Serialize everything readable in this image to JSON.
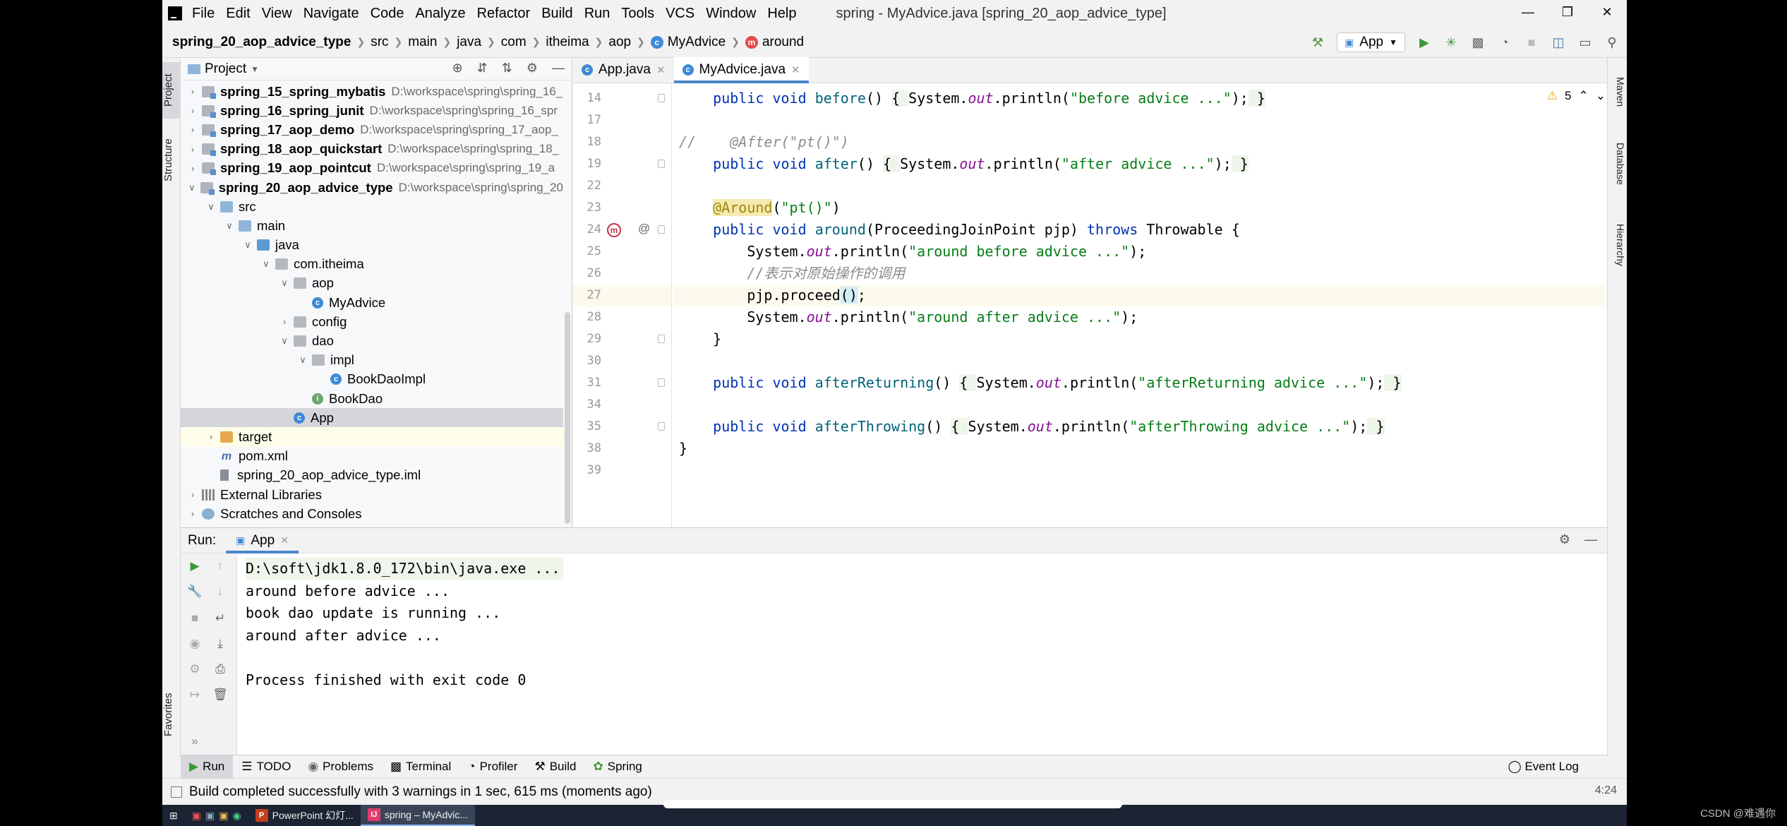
{
  "window": {
    "title": "spring - MyAdvice.java [spring_20_aop_advice_type]",
    "controls": [
      "minimize",
      "maximize",
      "close"
    ]
  },
  "menu": [
    "File",
    "Edit",
    "View",
    "Navigate",
    "Code",
    "Analyze",
    "Refactor",
    "Build",
    "Run",
    "Tools",
    "VCS",
    "Window",
    "Help"
  ],
  "breadcrumb": [
    "spring_20_aop_advice_type",
    "src",
    "main",
    "java",
    "com",
    "itheima",
    "aop",
    "MyAdvice",
    "around"
  ],
  "toolbar": {
    "run_config": "App"
  },
  "left_strip": {
    "project": "Project",
    "structure": "Structure",
    "favorites": "Favorites"
  },
  "right_strip": [
    "Maven",
    "Database",
    "Hierarchy"
  ],
  "project_panel": {
    "title": "Project",
    "tree": [
      {
        "name": "spring_15_spring_mybatis",
        "path": "D:\\workspace\\spring\\spring_16_",
        "level": 0,
        "arrow": ">",
        "icon": "module",
        "bold": true
      },
      {
        "name": "spring_16_spring_junit",
        "path": "D:\\workspace\\spring\\spring_16_spr",
        "level": 0,
        "arrow": ">",
        "icon": "module",
        "bold": true
      },
      {
        "name": "spring_17_aop_demo",
        "path": "D:\\workspace\\spring\\spring_17_aop_",
        "level": 0,
        "arrow": ">",
        "icon": "module",
        "bold": true
      },
      {
        "name": "spring_18_aop_quickstart",
        "path": "D:\\workspace\\spring\\spring_18_",
        "level": 0,
        "arrow": ">",
        "icon": "module",
        "bold": true
      },
      {
        "name": "spring_19_aop_pointcut",
        "path": "D:\\workspace\\spring\\spring_19_a",
        "level": 0,
        "arrow": ">",
        "icon": "module",
        "bold": true
      },
      {
        "name": "spring_20_aop_advice_type",
        "path": "D:\\workspace\\spring\\spring_20",
        "level": 0,
        "arrow": "v",
        "icon": "module",
        "bold": true
      },
      {
        "name": "src",
        "path": "",
        "level": 1,
        "arrow": "v",
        "icon": "folder",
        "bold": false
      },
      {
        "name": "main",
        "path": "",
        "level": 2,
        "arrow": "v",
        "icon": "folder",
        "bold": false
      },
      {
        "name": "java",
        "path": "",
        "level": 3,
        "arrow": "v",
        "icon": "java",
        "bold": false
      },
      {
        "name": "com.itheima",
        "path": "",
        "level": 4,
        "arrow": "v",
        "icon": "package",
        "bold": false
      },
      {
        "name": "aop",
        "path": "",
        "level": 5,
        "arrow": "v",
        "icon": "package",
        "bold": false
      },
      {
        "name": "MyAdvice",
        "path": "",
        "level": 6,
        "arrow": "",
        "icon": "class",
        "bold": false
      },
      {
        "name": "config",
        "path": "",
        "level": 5,
        "arrow": ">",
        "icon": "package",
        "bold": false
      },
      {
        "name": "dao",
        "path": "",
        "level": 5,
        "arrow": "v",
        "icon": "package",
        "bold": false
      },
      {
        "name": "impl",
        "path": "",
        "level": 6,
        "arrow": "v",
        "icon": "package",
        "bold": false
      },
      {
        "name": "BookDaoImpl",
        "path": "",
        "level": 7,
        "arrow": "",
        "icon": "class",
        "bold": false
      },
      {
        "name": "BookDao",
        "path": "",
        "level": 6,
        "arrow": "",
        "icon": "interface",
        "bold": false
      },
      {
        "name": "App",
        "path": "",
        "level": 5,
        "arrow": "",
        "icon": "class",
        "bold": false,
        "selected": true
      },
      {
        "name": "target",
        "path": "",
        "level": 1,
        "arrow": ">",
        "icon": "target",
        "bold": false,
        "highlight": true
      },
      {
        "name": "pom.xml",
        "path": "",
        "level": 1,
        "arrow": "",
        "icon": "maven",
        "bold": false
      },
      {
        "name": "spring_20_aop_advice_type.iml",
        "path": "",
        "level": 1,
        "arrow": "",
        "icon": "iml",
        "bold": false
      },
      {
        "name": "External Libraries",
        "path": "",
        "level": 0,
        "arrow": ">",
        "icon": "library",
        "bold": false
      },
      {
        "name": "Scratches and Consoles",
        "path": "",
        "level": 0,
        "arrow": ">",
        "icon": "scratch",
        "bold": false
      }
    ]
  },
  "editor": {
    "tabs": [
      {
        "label": "App.java",
        "active": false
      },
      {
        "label": "MyAdvice.java",
        "active": true
      }
    ],
    "warnings": "5",
    "lines": [
      {
        "num": "14",
        "text": "    public void before() { System.out.println(\"before advice ...\"); }"
      },
      {
        "num": "17",
        "text": ""
      },
      {
        "num": "18",
        "text": "//    @After(\"pt()\")"
      },
      {
        "num": "19",
        "text": "    public void after() { System.out.println(\"after advice ...\"); }"
      },
      {
        "num": "22",
        "text": ""
      },
      {
        "num": "23",
        "text": "    @Around(\"pt()\")"
      },
      {
        "num": "24",
        "text": "    public void around(ProceedingJoinPoint pjp) throws Throwable {"
      },
      {
        "num": "25",
        "text": "        System.out.println(\"around before advice ...\");"
      },
      {
        "num": "26",
        "text": "        //表示对原始操作的调用"
      },
      {
        "num": "27",
        "text": "        pjp.proceed();"
      },
      {
        "num": "28",
        "text": "        System.out.println(\"around after advice ...\");"
      },
      {
        "num": "29",
        "text": "    }"
      },
      {
        "num": "30",
        "text": ""
      },
      {
        "num": "31",
        "text": "    public void afterReturning() { System.out.println(\"afterReturning advice ...\"); }"
      },
      {
        "num": "34",
        "text": ""
      },
      {
        "num": "35",
        "text": "    public void afterThrowing() { System.out.println(\"afterThrowing advice ...\"); }"
      },
      {
        "num": "38",
        "text": "}"
      },
      {
        "num": "39",
        "text": ""
      }
    ],
    "tokens": {
      "public": "public",
      "void": "void",
      "throws": "throws",
      "before": "before",
      "after": "after",
      "around": "around",
      "afterReturning": "afterReturning",
      "afterThrowing": "afterThrowing",
      "system": "System.",
      "out": "out",
      "println": ".println(",
      "s_before": "\"before advice ...\"",
      "s_after": "\"after advice ...\"",
      "s_pt": "\"pt()\"",
      "around_sig": "(ProceedingJoinPoint pjp) ",
      "throwable": " Throwable {",
      "s_around_before": "\"around before advice ...\"",
      "s_around_after": "\"around after advice ...\"",
      "s_afterReturning": "\"afterReturning advice ...\"",
      "s_afterThrowing": "\"afterThrowing advice ...\"",
      "comment_after": "//    @After(\"pt()\")",
      "comment_cn": "//表示对原始操作的调用",
      "around_ann": "@Around",
      "pjp": "pjp.proceed",
      "paren": "()",
      "close_brace": "}"
    }
  },
  "run_panel": {
    "label": "Run:",
    "tab": "App",
    "output": [
      "D:\\soft\\jdk1.8.0_172\\bin\\java.exe ...",
      "around before advice ...",
      "book dao update is running ...",
      "around after advice ...",
      "",
      "Process finished with exit code 0"
    ]
  },
  "bottom_tabs": [
    "Run",
    "TODO",
    "Problems",
    "Terminal",
    "Profiler",
    "Build",
    "Spring"
  ],
  "event_log": "Event Log",
  "status": {
    "message": "Build completed successfully with 3 warnings in 1 sec, 615 ms (moments ago)",
    "position": "4:24"
  },
  "taskbar": {
    "items": [
      "PowerPoint 幻灯...",
      "spring – MyAdvic..."
    ]
  },
  "watermark": "CSDN @难遇你"
}
